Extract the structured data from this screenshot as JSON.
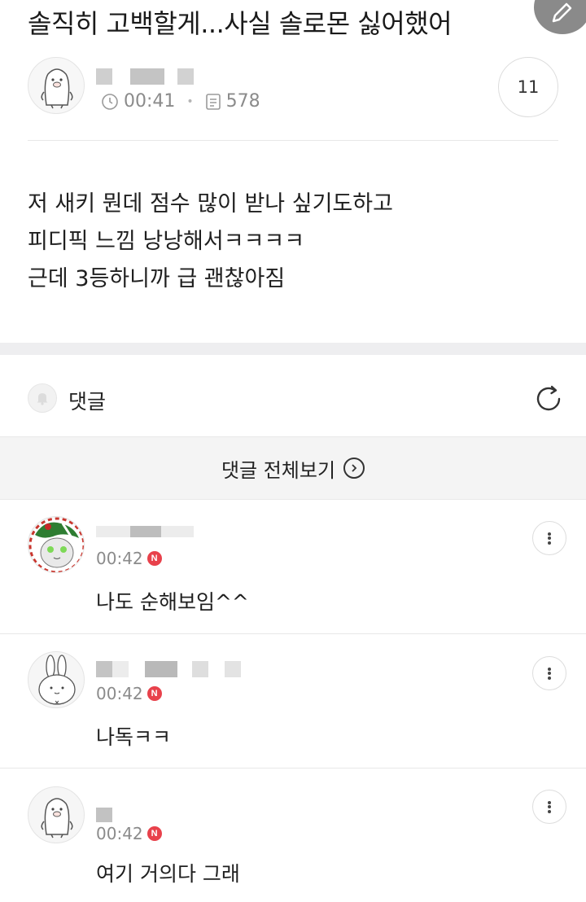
{
  "post": {
    "title": "솔직히 고백할게...사실 솔로몬 싫어했어",
    "time": "00:41",
    "views": "578",
    "comment_count": "11",
    "body_lines": [
      "저 새키 뭔데 점수 많이 받나 싶기도하고",
      "피디픽 느낌 낭낭해서ㅋㅋㅋㅋ",
      "근데 3등하니까 급 괜찮아짐"
    ]
  },
  "comments_section": {
    "label": "댓글",
    "view_all_label": "댓글 전체보기"
  },
  "comments": [
    {
      "time": "00:42",
      "new_badge": "N",
      "text": "나도 순해보임^^"
    },
    {
      "time": "00:42",
      "new_badge": "N",
      "text": "나독ㅋㅋ"
    },
    {
      "time": "00:42",
      "new_badge": "N",
      "text": "여기 거의다 그래"
    }
  ],
  "icons": {
    "edit": "pencil-icon",
    "clock": "clock-icon",
    "views": "document-icon",
    "bell": "bell-icon",
    "refresh": "refresh-icon",
    "view_all_arrow": "chevron-right-circle-icon",
    "more": "more-vertical-icon"
  },
  "colors": {
    "new_badge": "#e8414b",
    "meta_text": "#8b8b8b",
    "edit_fab": "#8a8a8a"
  }
}
